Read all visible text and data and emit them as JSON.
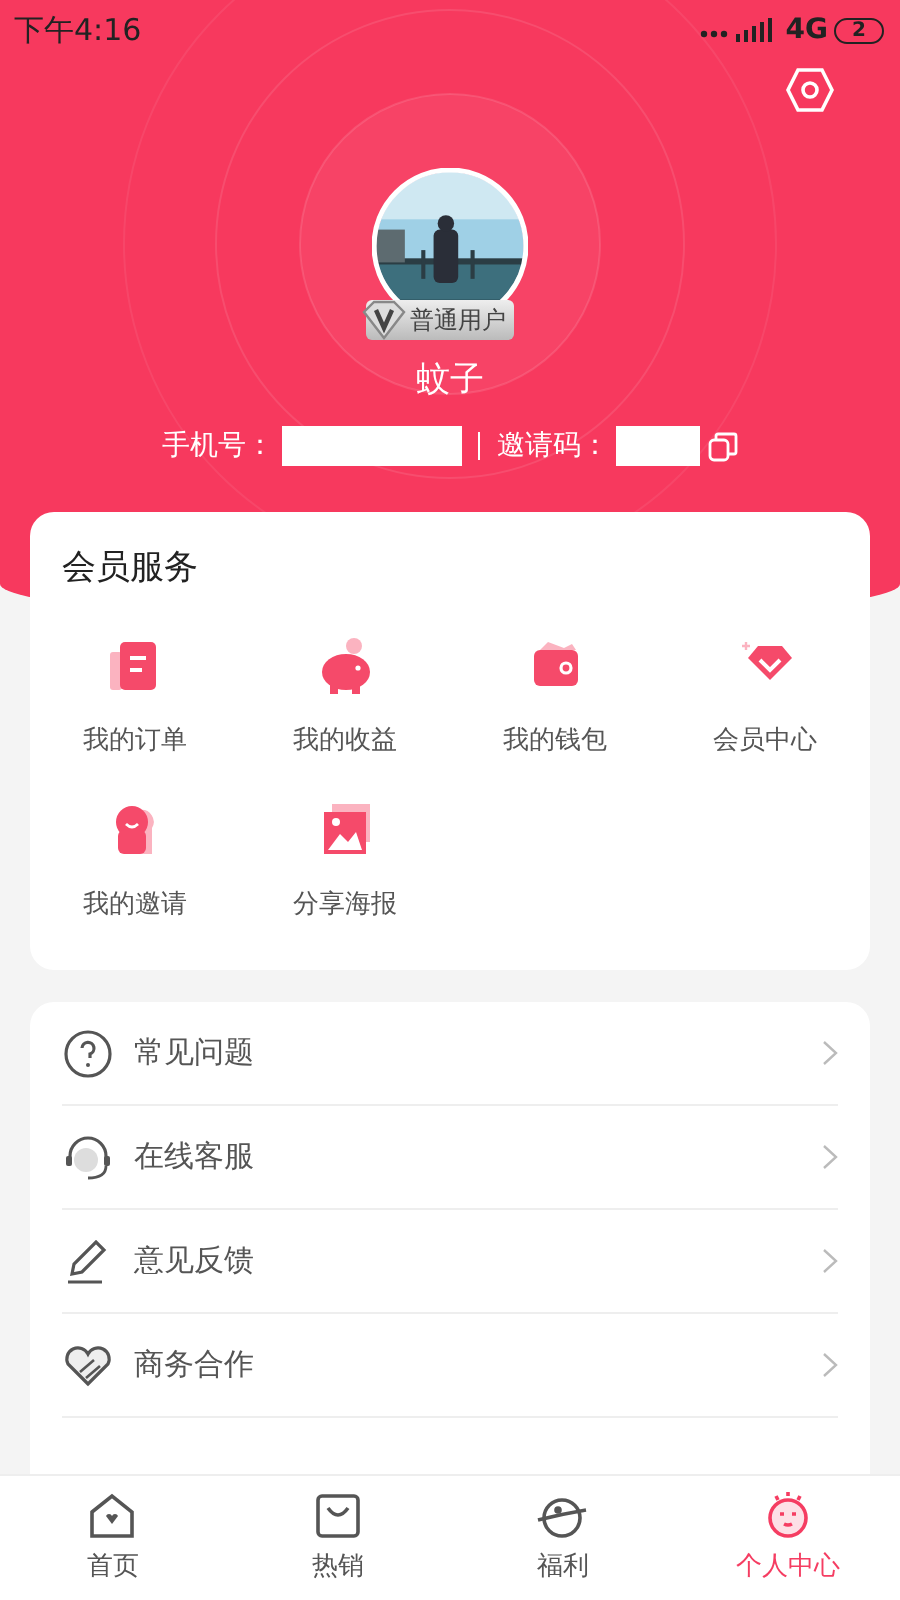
{
  "status_bar": {
    "time": "下午4:16",
    "network": "4G",
    "battery": "2"
  },
  "profile": {
    "badge": "普通用户",
    "name": "蚊子",
    "phone_label": "手机号：",
    "invite_label": "邀请码："
  },
  "services": {
    "title": "会员服务",
    "items": [
      {
        "kind": "order",
        "label": "我的订单"
      },
      {
        "kind": "income",
        "label": "我的收益"
      },
      {
        "kind": "wallet",
        "label": "我的钱包"
      },
      {
        "kind": "vip",
        "label": "会员中心"
      },
      {
        "kind": "invite",
        "label": "我的邀请"
      },
      {
        "kind": "poster",
        "label": "分享海报"
      }
    ]
  },
  "menu": [
    {
      "kind": "help",
      "label": "常见问题"
    },
    {
      "kind": "service",
      "label": "在线客服"
    },
    {
      "kind": "feedback",
      "label": "意见反馈"
    },
    {
      "kind": "cooperation",
      "label": "商务合作"
    }
  ],
  "tabs": [
    {
      "kind": "home",
      "label": "首页",
      "selected": false
    },
    {
      "kind": "hot",
      "label": "热销",
      "selected": false
    },
    {
      "kind": "welfare",
      "label": "福利",
      "selected": false
    },
    {
      "kind": "me",
      "label": "个人中心",
      "selected": true
    }
  ]
}
